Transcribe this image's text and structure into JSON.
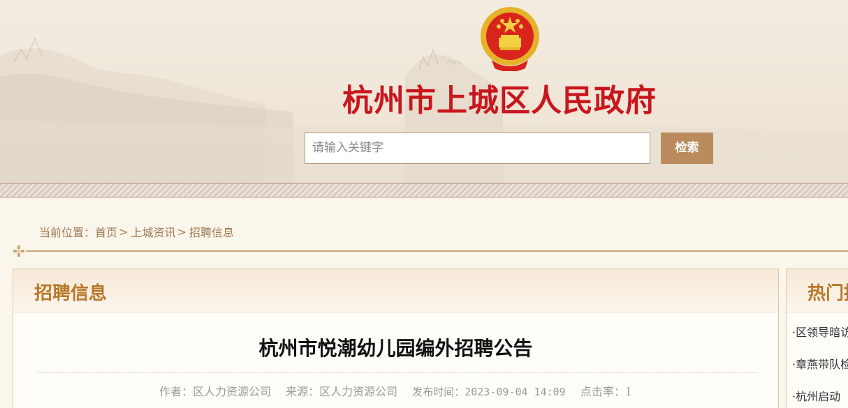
{
  "header": {
    "site_title": "杭州市上城区人民政府",
    "search_placeholder": "请输入关键字",
    "search_button": "检索",
    "emblem_icon": "national-emblem-icon"
  },
  "breadcrumb": {
    "prefix": "当前位置：",
    "items": [
      "首页",
      "上城资讯",
      "招聘信息"
    ],
    "separator": ">"
  },
  "main": {
    "section_title": "招聘信息",
    "article_title": "杭州市悦潮幼儿园编外招聘公告",
    "meta": {
      "author": "作者：区人力资源公司",
      "source": "来源：区人力资源公司",
      "publish_time": "发布时间：2023-09-04 14:09",
      "clicks": "点击率：1"
    }
  },
  "side": {
    "title": "热门推荐",
    "items": [
      "·区领导暗访",
      "·章燕带队检查",
      "·杭州启动"
    ]
  },
  "colors": {
    "title_red": "#c8161d",
    "accent_brown": "#b98b5d",
    "section_orange": "#b9782a"
  }
}
